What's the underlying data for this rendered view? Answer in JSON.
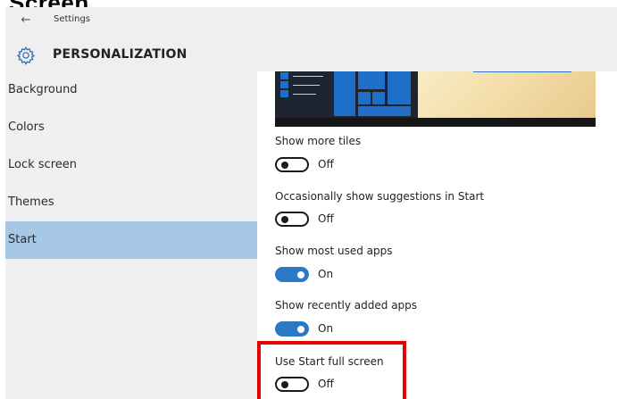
{
  "document": {
    "heading": "Screen."
  },
  "window": {
    "back_icon": "back-arrow-icon",
    "title": "Settings",
    "section_icon": "gear-icon",
    "section_title": "PERSONALIZATION"
  },
  "sidebar": {
    "items": [
      {
        "label": "Background",
        "selected": false
      },
      {
        "label": "Colors",
        "selected": false
      },
      {
        "label": "Lock screen",
        "selected": false
      },
      {
        "label": "Themes",
        "selected": false
      },
      {
        "label": "Start",
        "selected": true
      }
    ],
    "selected_color": "#a6c8e6"
  },
  "settings": [
    {
      "label": "Show more tiles",
      "state": "Off",
      "on": false
    },
    {
      "label": "Occasionally show suggestions in Start",
      "state": "Off",
      "on": false
    },
    {
      "label": "Show most used apps",
      "state": "On",
      "on": true
    },
    {
      "label": "Show recently added apps",
      "state": "On",
      "on": true
    },
    {
      "label": "Use Start full screen",
      "state": "Off",
      "on": false
    }
  ],
  "colors": {
    "toggle_on": "#2b78c5",
    "highlight": "#e60000",
    "titlebar": "#efefef",
    "sidebar": "#f0f0f0"
  }
}
